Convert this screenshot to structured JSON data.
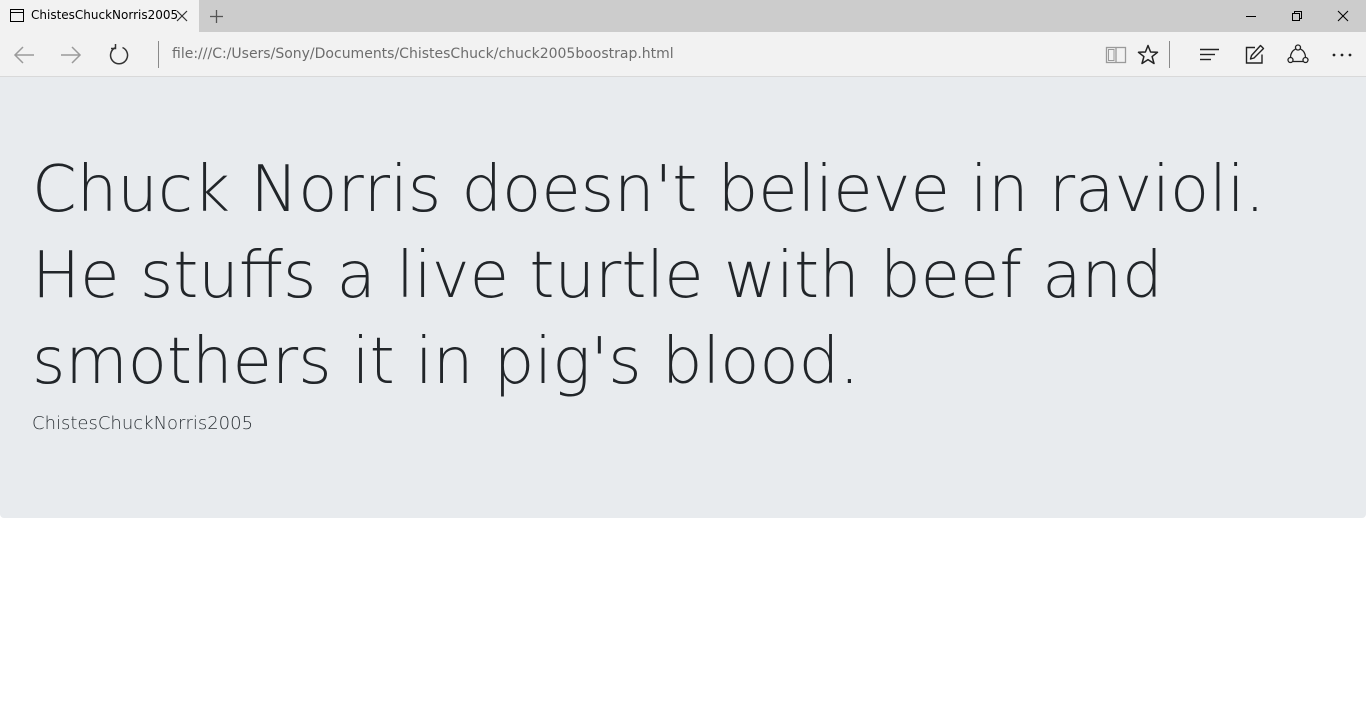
{
  "browser": {
    "tab_title": "ChistesChuckNorris2005",
    "address": "file:///C:/Users/Sony/Documents/ChistesChuck/chuck2005boostrap.html",
    "icons": {
      "tab": "page-icon",
      "tab_close": "close-icon",
      "new_tab": "plus-icon",
      "minimize": "minimize-icon",
      "restore": "restore-icon",
      "close": "close-icon",
      "back": "arrow-left-icon",
      "forward": "arrow-right-icon",
      "refresh": "refresh-icon",
      "reading_view": "book-icon",
      "favorite": "star-icon",
      "hub": "hub-icon",
      "web_note": "pen-icon",
      "share": "share-icon",
      "more": "more-icon"
    }
  },
  "page": {
    "joke": "Chuck Norris doesn't believe in ravioli. He stuffs a live turtle with beef and smothers it in pig's blood.",
    "byline": "ChistesChuckNorris2005"
  },
  "colors": {
    "jumbotron_bg": "#e8ebee",
    "text": "#212529",
    "chrome_bg": "#f2f2f2",
    "titlebar_bg": "#cccccc"
  }
}
